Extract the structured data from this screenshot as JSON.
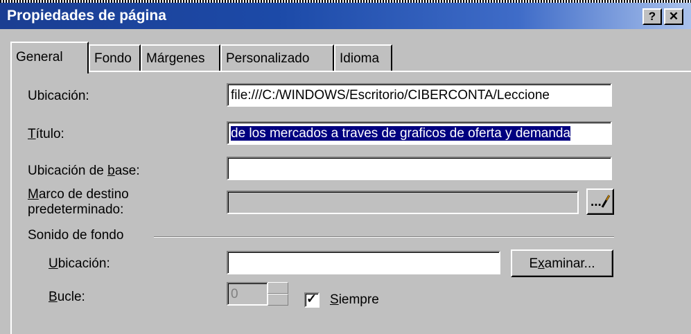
{
  "dialog": {
    "title": "Propiedades de página",
    "help_button": "?",
    "close_button": "✕"
  },
  "tabs": [
    {
      "label": "General"
    },
    {
      "label": "Fondo"
    },
    {
      "label": "Márgenes"
    },
    {
      "label": "Personalizado"
    },
    {
      "label": "Idioma"
    }
  ],
  "general": {
    "location_label": "Ubicación:",
    "location_value": "file:///C:/WINDOWS/Escritorio/CIBERCONTA/Leccione",
    "title_label_first": "T",
    "title_label_rest": "ítulo:",
    "title_value": "de los mercados a traves de graficos de oferta y demanda",
    "base_label_prefix": "Ubicación de ",
    "base_label_accel": "b",
    "base_label_suffix": "ase:",
    "base_value": "",
    "frame_label_first": "M",
    "frame_label_line1_rest": "arco de destino",
    "frame_label_line2": "predeterminado:",
    "frame_value": "",
    "frame_button": "..."
  },
  "background_sound": {
    "group_label": "Sonido de fondo",
    "location_label_first": "U",
    "location_label_rest": "bicación:",
    "location_value": "",
    "browse_first": "E",
    "browse_accel": "x",
    "browse_rest": "aminar...",
    "loop_label_first": "B",
    "loop_label_rest": "ucle:",
    "loop_value": "0",
    "always_label_first": "S",
    "always_label_rest": "iempre",
    "always_checked": true,
    "check_mark": "✓"
  }
}
